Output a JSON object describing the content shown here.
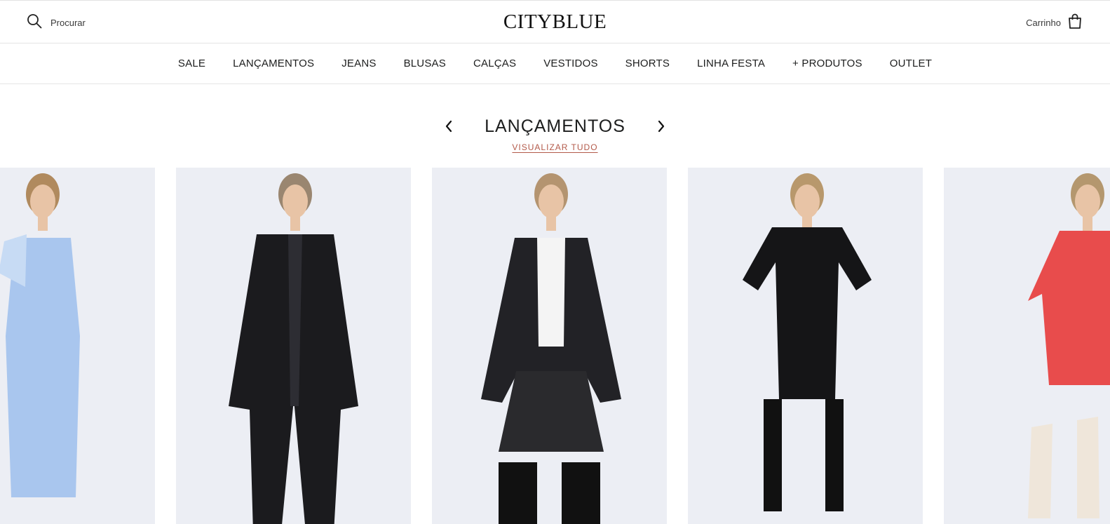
{
  "header": {
    "search_label": "Procurar",
    "logo_text": "CITYBLUE",
    "cart_label": "Carrinho"
  },
  "nav": {
    "items": [
      "SALE",
      "LANÇAMENTOS",
      "JEANS",
      "BLUSAS",
      "CALÇAS",
      "VESTIDOS",
      "SHORTS",
      "LINHA FESTA",
      "+ PRODUTOS",
      "OUTLET"
    ]
  },
  "section": {
    "title": "LANÇAMENTOS",
    "view_all": "VISUALIZAR TUDO"
  },
  "products": [
    {
      "garment": "light-blue-halter-gown",
      "color": "#a9c6ee"
    },
    {
      "garment": "black-blazer-and-pants",
      "color": "#1b1b1e"
    },
    {
      "garment": "black-leather-jacket-shorts-boots",
      "color": "#222226"
    },
    {
      "garment": "black-zip-dress-and-boots",
      "color": "#151517"
    },
    {
      "garment": "red-shirt-dress-cream-boots",
      "color": "#e84c4c"
    }
  ],
  "colors": {
    "accent_link": "#b35a4a",
    "text": "#1c1d1d",
    "card_bg": "#eceef4"
  }
}
